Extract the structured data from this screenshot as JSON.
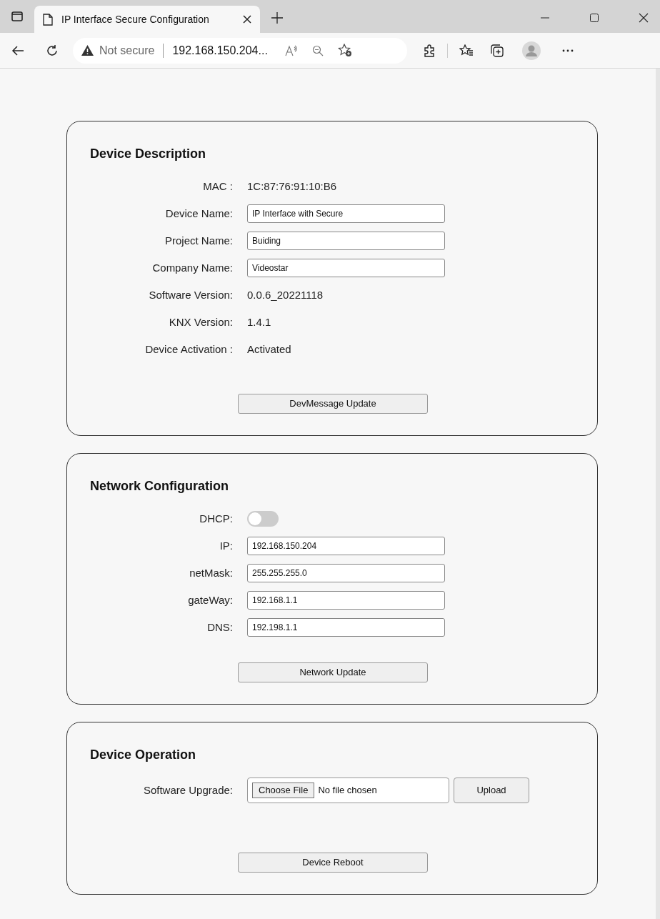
{
  "browser": {
    "tab_title": "IP Interface Secure Configuration",
    "security": "Not secure",
    "url": "192.168.150.204..."
  },
  "sections": [
    {
      "title": "Device Description",
      "rows": [
        {
          "kind": "text",
          "label": "MAC :",
          "value": "1C:87:76:91:10:B6"
        },
        {
          "kind": "input",
          "label": "Device Name:",
          "value": "IP Interface with Secure"
        },
        {
          "kind": "input",
          "label": "Project Name:",
          "value": "Buiding"
        },
        {
          "kind": "input",
          "label": "Company Name:",
          "value": "Videostar"
        },
        {
          "kind": "text",
          "label": "Software Version:",
          "value": "0.0.6_20221118"
        },
        {
          "kind": "text",
          "label": "KNX Version:",
          "value": "1.4.1"
        },
        {
          "kind": "text",
          "label": "Device Activation :",
          "value": "Activated"
        }
      ],
      "button": "DevMessage Update"
    },
    {
      "title": "Network Configuration",
      "rows": [
        {
          "kind": "toggle",
          "label": "DHCP:",
          "on": false
        },
        {
          "kind": "input",
          "label": "IP:",
          "value": "192.168.150.204"
        },
        {
          "kind": "input",
          "label": "netMask:",
          "value": "255.255.255.0"
        },
        {
          "kind": "input",
          "label": "gateWay:",
          "value": "192.168.1.1"
        },
        {
          "kind": "input",
          "label": "DNS:",
          "value": "192.198.1.1"
        }
      ],
      "button": "Network Update"
    },
    {
      "title": "Device Operation",
      "rows": [
        {
          "kind": "file",
          "label": "Software Upgrade:",
          "choose": "Choose File",
          "status": "No file chosen",
          "action": "Upload"
        }
      ],
      "button": "Device Reboot"
    }
  ]
}
